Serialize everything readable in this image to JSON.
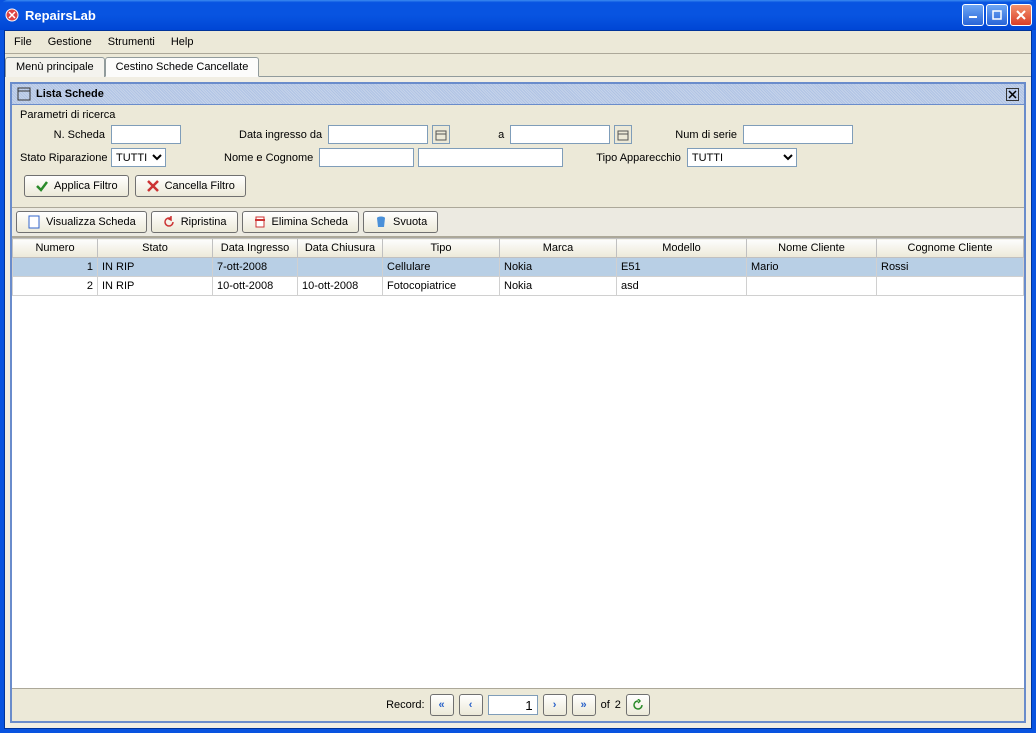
{
  "window": {
    "title": "RepairsLab"
  },
  "menus": {
    "file": "File",
    "gestione": "Gestione",
    "strumenti": "Strumenti",
    "help": "Help"
  },
  "tabs": {
    "main": "Menù principale",
    "cestino": "Cestino Schede Cancellate"
  },
  "panel": {
    "title": "Lista Schede"
  },
  "search": {
    "group_label": "Parametri di ricerca",
    "n_scheda_label": "N. Scheda",
    "data_ingresso_da_label": "Data ingresso da",
    "a_label": "a",
    "num_serie_label": "Num di serie",
    "stato_rip_label": "Stato Riparazione",
    "stato_rip_value": "TUTTI",
    "nome_cognome_label": "Nome e Cognome",
    "tipo_app_label": "Tipo Apparecchio",
    "tipo_app_value": "TUTTI"
  },
  "buttons": {
    "applica": "Applica Filtro",
    "cancella": "Cancella Filtro",
    "visualizza": "Visualizza Scheda",
    "ripristina": "Ripristina",
    "elimina": "Elimina Scheda",
    "svuota": "Svuota"
  },
  "columns": {
    "numero": "Numero",
    "stato": "Stato",
    "data_ingresso": "Data Ingresso",
    "data_chiusura": "Data Chiusura",
    "tipo": "Tipo",
    "marca": "Marca",
    "modello": "Modello",
    "nome_cliente": "Nome Cliente",
    "cognome_cliente": "Cognome Cliente"
  },
  "rows": [
    {
      "numero": "1",
      "stato": "IN RIP",
      "data_ingresso": "7-ott-2008",
      "data_chiusura": "",
      "tipo": "Cellulare",
      "marca": "Nokia",
      "modello": "E51",
      "nome_cliente": "Mario",
      "cognome_cliente": "Rossi"
    },
    {
      "numero": "2",
      "stato": "IN RIP",
      "data_ingresso": "10-ott-2008",
      "data_chiusura": "10-ott-2008",
      "tipo": "Fotocopiatrice",
      "marca": "Nokia",
      "modello": "asd",
      "nome_cliente": "",
      "cognome_cliente": ""
    }
  ],
  "footer": {
    "record_label": "Record:",
    "current": "1",
    "of_label": "of",
    "total": "2"
  }
}
